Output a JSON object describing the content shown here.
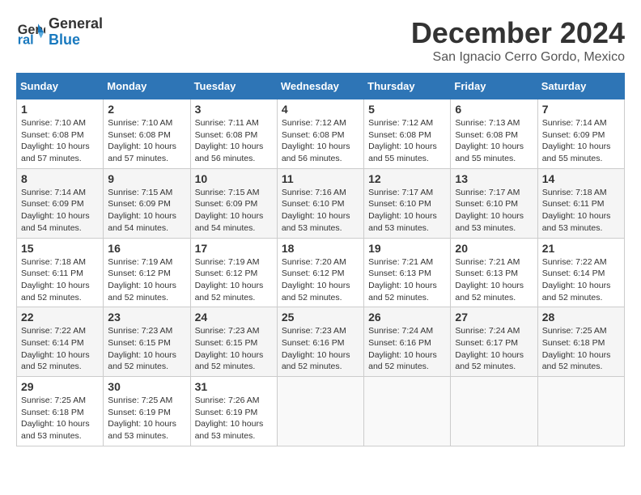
{
  "header": {
    "logo_line1": "General",
    "logo_line2": "Blue",
    "month": "December 2024",
    "location": "San Ignacio Cerro Gordo, Mexico"
  },
  "weekdays": [
    "Sunday",
    "Monday",
    "Tuesday",
    "Wednesday",
    "Thursday",
    "Friday",
    "Saturday"
  ],
  "weeks": [
    [
      {
        "day": "1",
        "info": "Sunrise: 7:10 AM\nSunset: 6:08 PM\nDaylight: 10 hours\nand 57 minutes."
      },
      {
        "day": "2",
        "info": "Sunrise: 7:10 AM\nSunset: 6:08 PM\nDaylight: 10 hours\nand 57 minutes."
      },
      {
        "day": "3",
        "info": "Sunrise: 7:11 AM\nSunset: 6:08 PM\nDaylight: 10 hours\nand 56 minutes."
      },
      {
        "day": "4",
        "info": "Sunrise: 7:12 AM\nSunset: 6:08 PM\nDaylight: 10 hours\nand 56 minutes."
      },
      {
        "day": "5",
        "info": "Sunrise: 7:12 AM\nSunset: 6:08 PM\nDaylight: 10 hours\nand 55 minutes."
      },
      {
        "day": "6",
        "info": "Sunrise: 7:13 AM\nSunset: 6:08 PM\nDaylight: 10 hours\nand 55 minutes."
      },
      {
        "day": "7",
        "info": "Sunrise: 7:14 AM\nSunset: 6:09 PM\nDaylight: 10 hours\nand 55 minutes."
      }
    ],
    [
      {
        "day": "8",
        "info": "Sunrise: 7:14 AM\nSunset: 6:09 PM\nDaylight: 10 hours\nand 54 minutes."
      },
      {
        "day": "9",
        "info": "Sunrise: 7:15 AM\nSunset: 6:09 PM\nDaylight: 10 hours\nand 54 minutes."
      },
      {
        "day": "10",
        "info": "Sunrise: 7:15 AM\nSunset: 6:09 PM\nDaylight: 10 hours\nand 54 minutes."
      },
      {
        "day": "11",
        "info": "Sunrise: 7:16 AM\nSunset: 6:10 PM\nDaylight: 10 hours\nand 53 minutes."
      },
      {
        "day": "12",
        "info": "Sunrise: 7:17 AM\nSunset: 6:10 PM\nDaylight: 10 hours\nand 53 minutes."
      },
      {
        "day": "13",
        "info": "Sunrise: 7:17 AM\nSunset: 6:10 PM\nDaylight: 10 hours\nand 53 minutes."
      },
      {
        "day": "14",
        "info": "Sunrise: 7:18 AM\nSunset: 6:11 PM\nDaylight: 10 hours\nand 53 minutes."
      }
    ],
    [
      {
        "day": "15",
        "info": "Sunrise: 7:18 AM\nSunset: 6:11 PM\nDaylight: 10 hours\nand 52 minutes."
      },
      {
        "day": "16",
        "info": "Sunrise: 7:19 AM\nSunset: 6:12 PM\nDaylight: 10 hours\nand 52 minutes."
      },
      {
        "day": "17",
        "info": "Sunrise: 7:19 AM\nSunset: 6:12 PM\nDaylight: 10 hours\nand 52 minutes."
      },
      {
        "day": "18",
        "info": "Sunrise: 7:20 AM\nSunset: 6:12 PM\nDaylight: 10 hours\nand 52 minutes."
      },
      {
        "day": "19",
        "info": "Sunrise: 7:21 AM\nSunset: 6:13 PM\nDaylight: 10 hours\nand 52 minutes."
      },
      {
        "day": "20",
        "info": "Sunrise: 7:21 AM\nSunset: 6:13 PM\nDaylight: 10 hours\nand 52 minutes."
      },
      {
        "day": "21",
        "info": "Sunrise: 7:22 AM\nSunset: 6:14 PM\nDaylight: 10 hours\nand 52 minutes."
      }
    ],
    [
      {
        "day": "22",
        "info": "Sunrise: 7:22 AM\nSunset: 6:14 PM\nDaylight: 10 hours\nand 52 minutes."
      },
      {
        "day": "23",
        "info": "Sunrise: 7:23 AM\nSunset: 6:15 PM\nDaylight: 10 hours\nand 52 minutes."
      },
      {
        "day": "24",
        "info": "Sunrise: 7:23 AM\nSunset: 6:15 PM\nDaylight: 10 hours\nand 52 minutes."
      },
      {
        "day": "25",
        "info": "Sunrise: 7:23 AM\nSunset: 6:16 PM\nDaylight: 10 hours\nand 52 minutes."
      },
      {
        "day": "26",
        "info": "Sunrise: 7:24 AM\nSunset: 6:16 PM\nDaylight: 10 hours\nand 52 minutes."
      },
      {
        "day": "27",
        "info": "Sunrise: 7:24 AM\nSunset: 6:17 PM\nDaylight: 10 hours\nand 52 minutes."
      },
      {
        "day": "28",
        "info": "Sunrise: 7:25 AM\nSunset: 6:18 PM\nDaylight: 10 hours\nand 52 minutes."
      }
    ],
    [
      {
        "day": "29",
        "info": "Sunrise: 7:25 AM\nSunset: 6:18 PM\nDaylight: 10 hours\nand 53 minutes."
      },
      {
        "day": "30",
        "info": "Sunrise: 7:25 AM\nSunset: 6:19 PM\nDaylight: 10 hours\nand 53 minutes."
      },
      {
        "day": "31",
        "info": "Sunrise: 7:26 AM\nSunset: 6:19 PM\nDaylight: 10 hours\nand 53 minutes."
      },
      {
        "day": "",
        "info": ""
      },
      {
        "day": "",
        "info": ""
      },
      {
        "day": "",
        "info": ""
      },
      {
        "day": "",
        "info": ""
      }
    ]
  ]
}
